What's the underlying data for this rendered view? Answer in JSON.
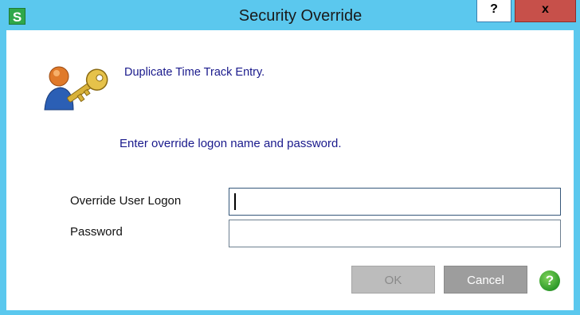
{
  "window": {
    "title": "Security Override",
    "app_icon_letter": "S",
    "help_button": "?",
    "close_button": "x"
  },
  "messages": {
    "heading": "Duplicate Time Track Entry.",
    "instruction": "Enter override logon name and password."
  },
  "form": {
    "user_logon_label": "Override User Logon",
    "user_logon_value": "",
    "password_label": "Password",
    "password_value": ""
  },
  "buttons": {
    "ok_label": "OK",
    "cancel_label": "Cancel",
    "help_label": "?"
  },
  "colors": {
    "titlebar": "#5bc8ee",
    "close": "#c7504a",
    "message_text": "#1a1a8c",
    "app_icon": "#2fa84a",
    "help_icon": "#2e9a2a"
  },
  "icons": {
    "app": "sage-s-icon",
    "dialog": "user-key-icon",
    "help": "help-circle-icon"
  }
}
